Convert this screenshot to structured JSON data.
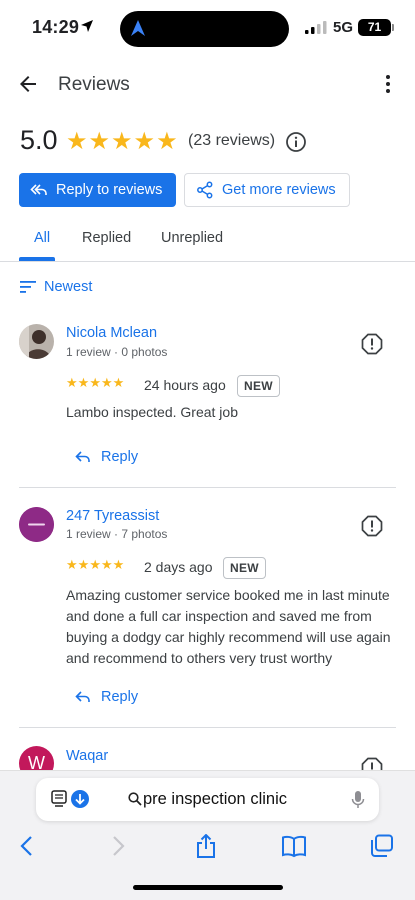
{
  "status_bar": {
    "time": "14:29",
    "network": "5G",
    "battery": "71",
    "battery_level": 0.71
  },
  "header": {
    "title": "Reviews"
  },
  "summary": {
    "rating": "5.0",
    "stars": 5,
    "review_count": "(23 reviews)"
  },
  "actions": {
    "reply_to_reviews": "Reply to reviews",
    "get_more_reviews": "Get more reviews"
  },
  "tabs": [
    {
      "label": "All",
      "selected": true
    },
    {
      "label": "Replied",
      "selected": false
    },
    {
      "label": "Unreplied",
      "selected": false
    }
  ],
  "sort": {
    "label": "Newest"
  },
  "reviews": [
    {
      "name": "Nicola Mclean",
      "meta": "1 review · 0 photos",
      "stars": 5,
      "time": "24 hours ago",
      "badge": "NEW",
      "text": "Lambo inspected. Great job",
      "reply_label": "Reply"
    },
    {
      "name": "247 Tyreassist",
      "meta": "1 review · 7 photos",
      "stars": 5,
      "time": "2 days ago",
      "badge": "NEW",
      "text": "Amazing customer service booked me in last minute and done a full car inspection and saved me from buying a dodgy car highly recommend will use again and recommend to others very trust worthy",
      "reply_label": "Reply",
      "avatar_color": "#8e2a86"
    },
    {
      "name": "Waqar",
      "avatar_initial": "W",
      "avatar_color": "#c2185b"
    }
  ],
  "browser": {
    "address_text": "pre inspection clinic"
  },
  "colors": {
    "accent": "#1a73e8",
    "star": "#f9b71c"
  }
}
